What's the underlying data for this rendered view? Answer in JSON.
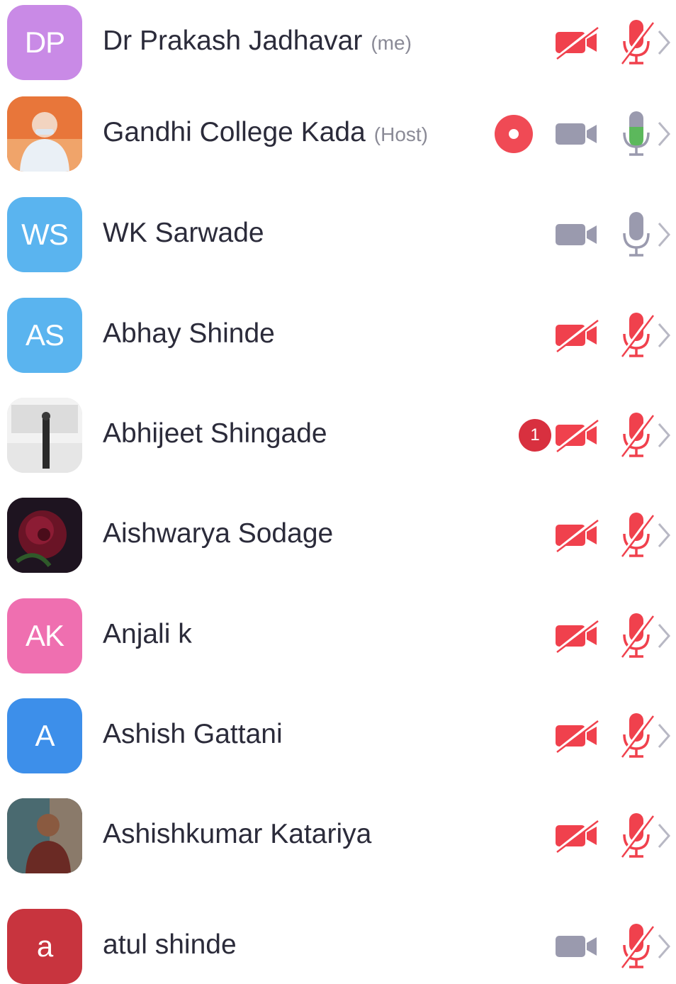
{
  "participants": [
    {
      "name": "Dr Prakash Jadhavar",
      "tag": "(me)",
      "avatar": {
        "type": "initials",
        "text": "DP",
        "color": "#c98ae6"
      },
      "video": "off",
      "audio": "muted",
      "badge": null
    },
    {
      "name": "Gandhi College Kada",
      "tag": "(Host)",
      "avatar": {
        "type": "photo",
        "icon": "person-photo-icon",
        "color": "#e8763a"
      },
      "video": "on",
      "audio": "speaking",
      "badge": {
        "type": "recording",
        "icon": "record-icon"
      }
    },
    {
      "name": "WK Sarwade",
      "tag": "",
      "avatar": {
        "type": "initials",
        "text": "WS",
        "color": "#5ab4ef"
      },
      "video": "on",
      "audio": "on",
      "badge": null
    },
    {
      "name": "Abhay Shinde",
      "tag": "",
      "avatar": {
        "type": "initials",
        "text": "AS",
        "color": "#5ab4ef"
      },
      "video": "off",
      "audio": "muted",
      "badge": null
    },
    {
      "name": "Abhijeet Shingade",
      "tag": "",
      "avatar": {
        "type": "photo",
        "icon": "person-photo-icon",
        "color": "#d8d8d8"
      },
      "video": "off",
      "audio": "muted",
      "badge": {
        "type": "count",
        "text": "1"
      }
    },
    {
      "name": "Aishwarya Sodage",
      "tag": "",
      "avatar": {
        "type": "photo",
        "icon": "rose-photo-icon",
        "color": "#2a1018"
      },
      "video": "off",
      "audio": "muted",
      "badge": null
    },
    {
      "name": "Anjali k",
      "tag": "",
      "avatar": {
        "type": "initials",
        "text": "AK",
        "color": "#ef6fb0"
      },
      "video": "off",
      "audio": "muted",
      "badge": null
    },
    {
      "name": "Ashish Gattani",
      "tag": "",
      "avatar": {
        "type": "initials",
        "text": "A",
        "color": "#3d8fea"
      },
      "video": "off",
      "audio": "muted",
      "badge": null
    },
    {
      "name": "Ashishkumar Katariya",
      "tag": "",
      "avatar": {
        "type": "photo",
        "icon": "person-photo-icon",
        "color": "#5a3a30"
      },
      "video": "off",
      "audio": "muted",
      "badge": null
    },
    {
      "name": "atul shinde",
      "tag": "",
      "avatar": {
        "type": "initials",
        "text": "a",
        "color": "#c8343e"
      },
      "video": "on",
      "audio": "muted",
      "badge": null
    }
  ],
  "colors": {
    "muted_red": "#f0414d",
    "icon_gray": "#9a9aae",
    "speaking_green": "#5cb85c",
    "chevron_gray": "#b8b8c4"
  }
}
